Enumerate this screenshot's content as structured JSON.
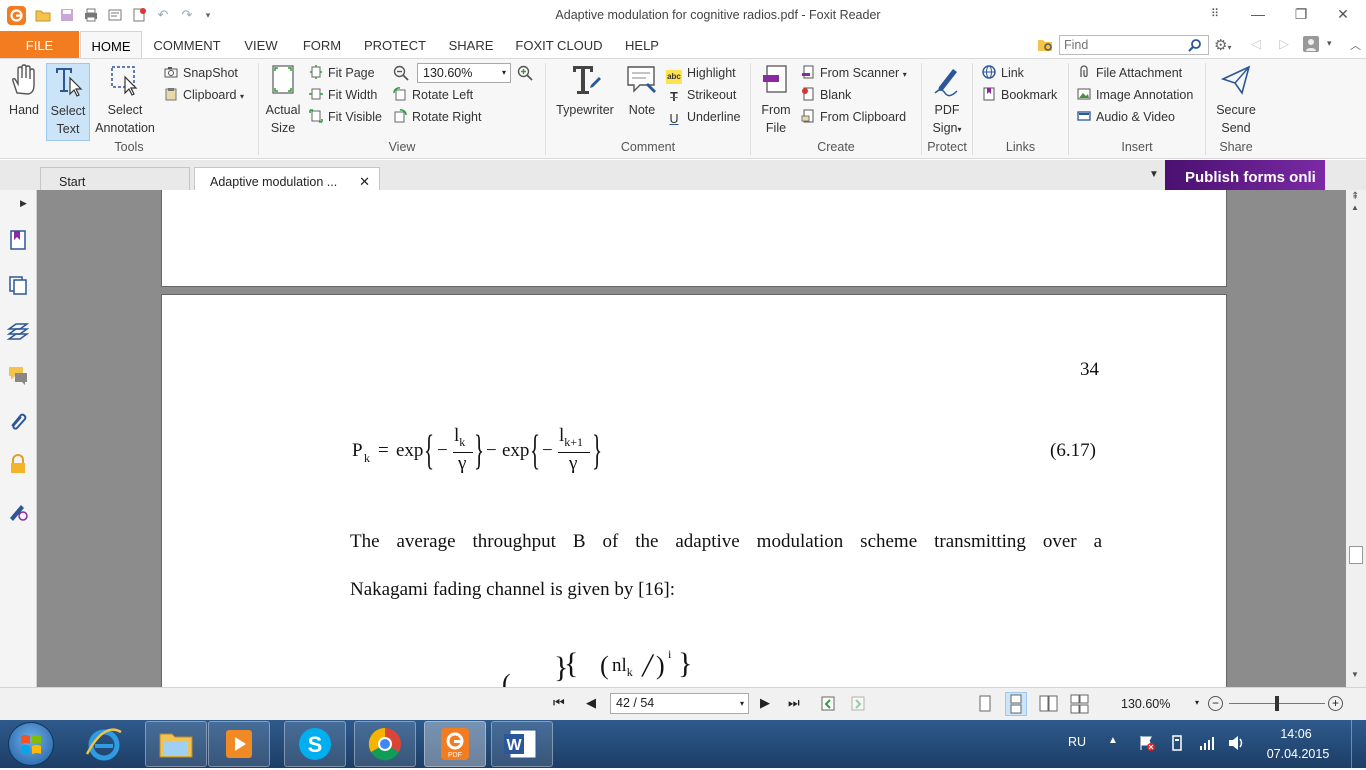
{
  "window": {
    "title": "Adaptive modulation for cognitive radios.pdf - Foxit Reader"
  },
  "menu": {
    "file": "FILE",
    "tabs": [
      "HOME",
      "COMMENT",
      "VIEW",
      "FORM",
      "PROTECT",
      "SHARE",
      "FOXIT CLOUD",
      "HELP"
    ],
    "active_tab": "HOME",
    "search_placeholder": "Find"
  },
  "ribbon": {
    "tools": {
      "label": "Tools",
      "hand": "Hand",
      "select_text": [
        "Select",
        "Text"
      ],
      "select_annotation": [
        "Select",
        "Annotation"
      ],
      "snapshot": "SnapShot",
      "clipboard": "Clipboard"
    },
    "view": {
      "label": "View",
      "actual_size": [
        "Actual",
        "Size"
      ],
      "fit_page": "Fit Page",
      "fit_width": "Fit Width",
      "fit_visible": "Fit Visible",
      "zoom": "130.60%",
      "rotate_left": "Rotate Left",
      "rotate_right": "Rotate Right"
    },
    "comment": {
      "label": "Comment",
      "typewriter": "Typewriter",
      "note": "Note",
      "highlight": "Highlight",
      "strikeout": "Strikeout",
      "underline": "Underline"
    },
    "create": {
      "label": "Create",
      "from_file": [
        "From",
        "File"
      ],
      "from_scanner": "From Scanner",
      "blank": "Blank",
      "from_clipboard": "From Clipboard"
    },
    "protect": {
      "label": "Protect",
      "pdf_sign": [
        "PDF",
        "Sign"
      ]
    },
    "links": {
      "label": "Links",
      "link": "Link",
      "bookmark": "Bookmark"
    },
    "insert": {
      "label": "Insert",
      "file_attachment": "File Attachment",
      "image_annotation": "Image Annotation",
      "audio_video": "Audio & Video"
    },
    "share": {
      "label": "Share",
      "secure_send": [
        "Secure",
        "Send"
      ]
    }
  },
  "tabs": {
    "start": "Start",
    "document": "Adaptive modulation ...",
    "ad_banner": "Publish forms onli"
  },
  "document": {
    "page_number": "34",
    "eq_number": "(6.17)",
    "eq": {
      "P": "P",
      "k": "k",
      "eq": "=",
      "exp": "exp",
      "minus": "−",
      "lk": "l",
      "lk_sub": "k",
      "gamma": "γ",
      "lk1_sub": "k+1",
      "nl": "nl",
      "i": "i"
    },
    "paragraph_line1": "The average throughput B of the adaptive modulation scheme transmitting over a",
    "paragraph_line2": "Nakagami fading channel is given by [16]:"
  },
  "status": {
    "page_field": "42 / 54",
    "zoom": "130.60%"
  },
  "taskbar": {
    "lang": "RU",
    "time": "14:06",
    "date": "07.04.2015"
  },
  "colors": {
    "accent_orange": "#f47c20",
    "ad_purple": "#6a1b9a",
    "taskbar_blue": "#1d3e66"
  }
}
